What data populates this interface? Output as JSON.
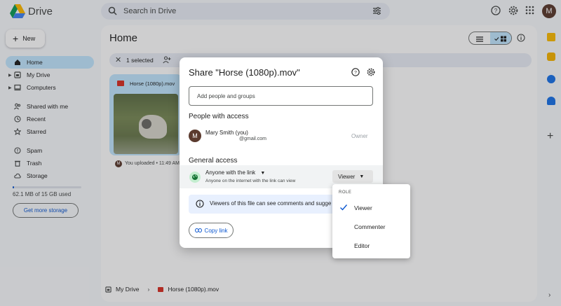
{
  "app": {
    "name": "Drive"
  },
  "search": {
    "placeholder": "Search in Drive"
  },
  "user": {
    "initial": "M"
  },
  "sidebar": {
    "new_label": "New",
    "items": [
      {
        "label": "Home",
        "icon": "home-icon",
        "active": true
      },
      {
        "label": "My Drive",
        "icon": "drive-icon"
      },
      {
        "label": "Computers",
        "icon": "computer-icon"
      },
      {
        "label": "Shared with me",
        "icon": "people-icon"
      },
      {
        "label": "Recent",
        "icon": "clock-icon"
      },
      {
        "label": "Starred",
        "icon": "star-icon"
      },
      {
        "label": "Spam",
        "icon": "spam-icon"
      },
      {
        "label": "Trash",
        "icon": "trash-icon"
      },
      {
        "label": "Storage",
        "icon": "cloud-icon"
      }
    ],
    "storage_used_fraction": 0.004,
    "storage_text": "62.1 MB of 15 GB used",
    "get_storage_label": "Get more storage"
  },
  "main": {
    "title": "Home",
    "selection_text": "1 selected",
    "file": {
      "name": "Horse (1080p).mov",
      "owner_initial": "M",
      "uploaded_text": "You uploaded • 11:49 AM"
    },
    "breadcrumb": {
      "root": "My Drive",
      "file": "Horse (1080p).mov"
    }
  },
  "share_dialog": {
    "title": "Share \"Horse (1080p).mov\"",
    "add_placeholder": "Add people and groups",
    "people_heading": "People with access",
    "person": {
      "initial": "M",
      "name": "Mary Smith (you)",
      "email": "@gmail.com",
      "role": "Owner"
    },
    "general_heading": "General access",
    "access_option": "Anyone with the link",
    "access_description": "Anyone on the internet with the link can view",
    "access_role": "Viewer",
    "info_text": "Viewers of this file can see comments and sugge",
    "copy_link_label": "Copy link"
  },
  "role_menu": {
    "heading": "ROLE",
    "options": [
      "Viewer",
      "Commenter",
      "Editor"
    ],
    "selected": "Viewer"
  },
  "colors": {
    "accent": "#0b57d0",
    "active_nav": "#c2e7ff"
  }
}
